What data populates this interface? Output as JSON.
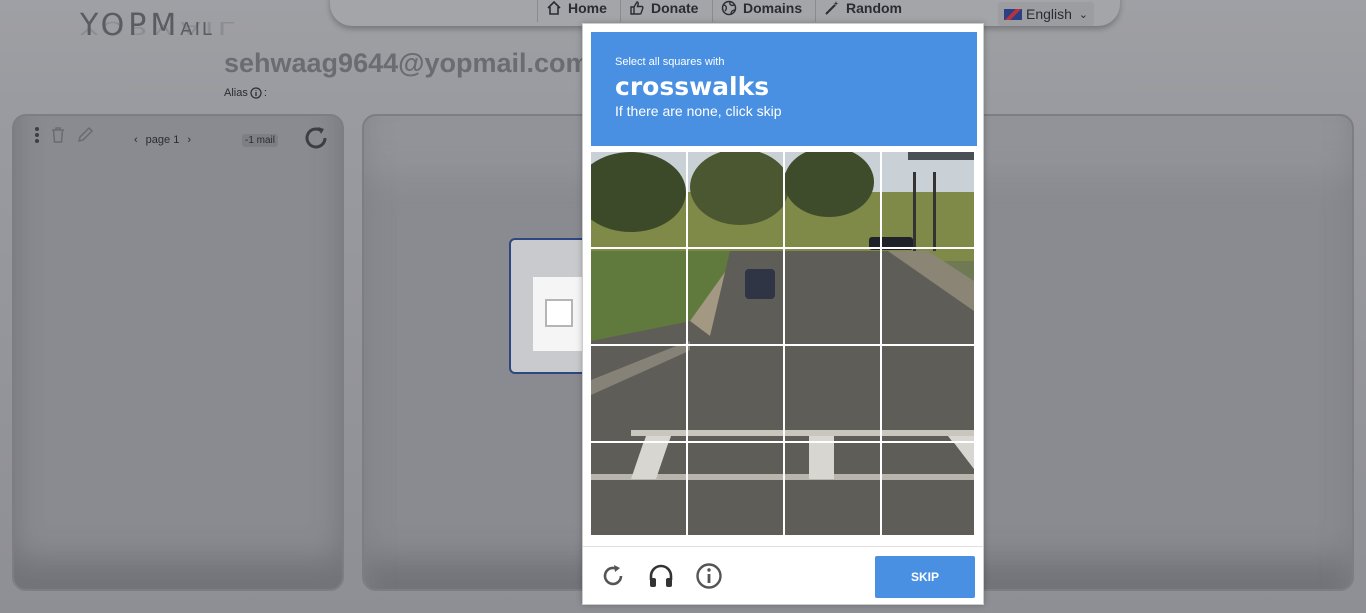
{
  "background": {
    "logo": {
      "main": "YOPM",
      "tail": "AIL"
    },
    "nav": {
      "home": "Home",
      "donate": "Donate",
      "domains": "Domains",
      "random": "Random",
      "language": "English"
    },
    "email": "sehwaag9644@yopmail.com",
    "alias_label": "Alias",
    "alias_suffix": ":",
    "pager": {
      "prev": "‹",
      "label": "page 1",
      "next": "›"
    },
    "mail_count": "-1 mail"
  },
  "captcha": {
    "instruction_small": "Select all squares with",
    "target": "crosswalks",
    "instruction_sub": "If there are none, click skip",
    "skip_label": "SKIP",
    "icons": [
      "reload-icon",
      "headphones-icon",
      "info-icon"
    ],
    "accent": "#4a90e2"
  }
}
